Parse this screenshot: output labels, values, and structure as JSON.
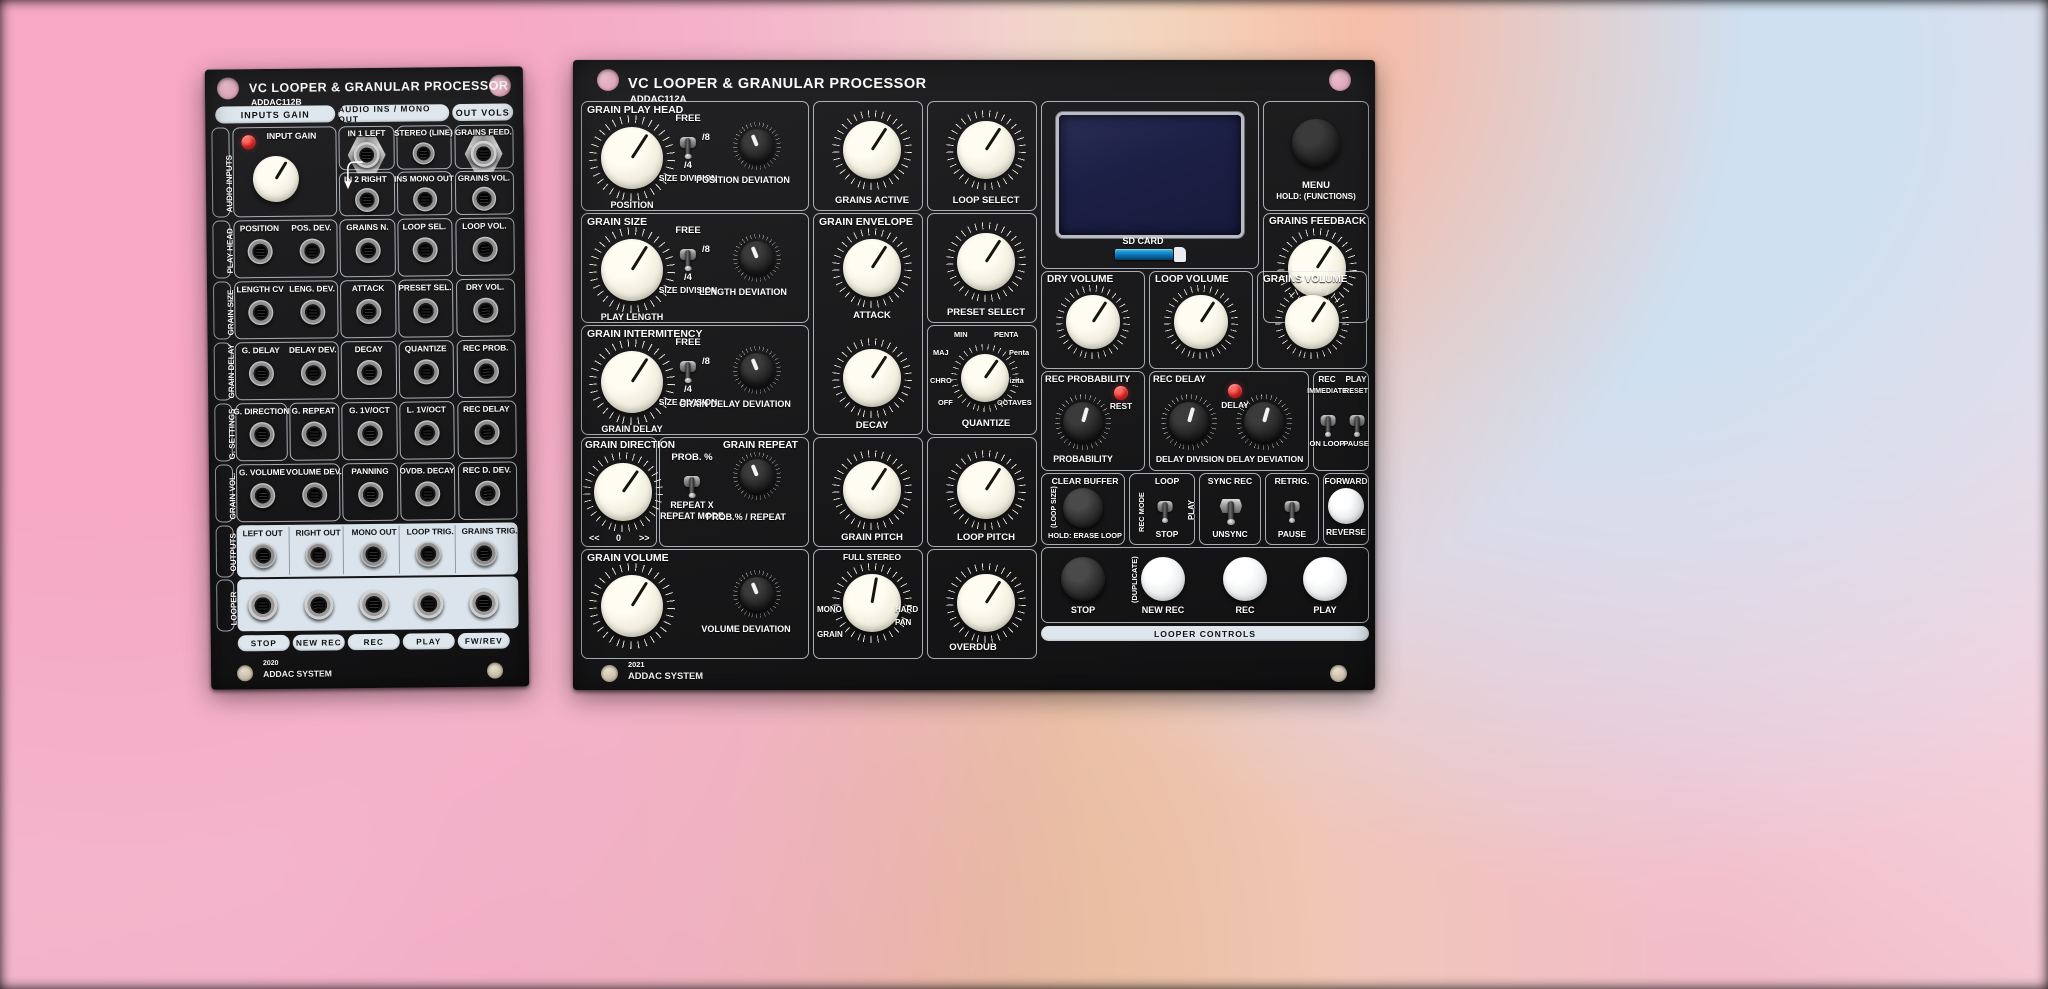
{
  "scene": {
    "background_description": "soft blurred pastel bokeh"
  },
  "module_b": {
    "title": "VC LOOPER & GRANULAR PROCESSOR",
    "model": "ADDAC112B",
    "year": "2020",
    "brand": "ADDAC SYSTEM",
    "pills": [
      "INPUTS GAIN",
      "AUDIO INS / MONO OUT",
      "OUT VOLS"
    ],
    "side_labels": [
      "AUDIO INPUTS",
      "PLAY HEAD",
      "GRAIN SIZE",
      "GRAIN DELAY",
      "G. SETTINGS",
      "GRAIN VOL.",
      "OUTPUTS",
      "LOOPER"
    ],
    "input_gain_label": "INPUT GAIN",
    "audio_in_labels": [
      "IN 1 LEFT",
      "IN 2 RIGHT",
      "STEREO (LINE)",
      "INS MONO OUT"
    ],
    "out_vol_labels": [
      "GRAINS FEED.",
      "GRAINS VOL.",
      "LOOP VOL.",
      "DRY VOL.",
      "REC PROB.",
      "REC DELAY",
      "REC D. DEV."
    ],
    "cv_rows": [
      [
        "POSITION",
        "POS. DEV.",
        "GRAINS N.",
        "LOOP SEL.",
        "LOOP VOL."
      ],
      [
        "LENGTH CV",
        "LENG. DEV.",
        "ATTACK",
        "PRESET SEL.",
        "DRY VOL."
      ],
      [
        "G. DELAY",
        "DELAY DEV.",
        "DECAY",
        "QUANTIZE",
        "REC PROB."
      ],
      [
        "G. DIRECTION",
        "G. REPEAT",
        "G. 1V/OCT",
        "L. 1V/OCT",
        "REC DELAY"
      ],
      [
        "G. VOLUME",
        "VOLUME DEV.",
        "PANNING",
        "OVDB. DECAY",
        "REC D. DEV."
      ]
    ],
    "output_labels": [
      "LEFT OUT",
      "RIGHT OUT",
      "MONO OUT",
      "LOOP TRIG.",
      "GRAINS TRIG."
    ],
    "footer_buttons": [
      "STOP",
      "NEW REC",
      "REC",
      "PLAY",
      "FW/REV"
    ]
  },
  "module_a": {
    "title": "VC LOOPER & GRANULAR PROCESSOR",
    "model": "ADDAC112A",
    "year": "2021",
    "brand": "ADDAC SYSTEM",
    "sections": {
      "grain_play_head": {
        "box_label": "GRAIN PLAY HEAD",
        "knob_label": "POSITION",
        "switch_top": "FREE",
        "switch_right": "/8",
        "switch_bottom": "/4",
        "switch_caption": "SIZE DIVISION",
        "dev_label": "POSITION DEVIATION"
      },
      "grain_size": {
        "box_label": "GRAIN SIZE",
        "knob_label": "PLAY LENGTH",
        "switch_top": "FREE",
        "switch_right": "/8",
        "switch_bottom": "/4",
        "switch_caption": "SIZE DIVISION",
        "dev_label": "LENGTH DEVIATION"
      },
      "grain_intermitency": {
        "box_label": "GRAIN INTERMITENCY",
        "knob_label": "GRAIN DELAY",
        "switch_top": "FREE",
        "switch_right": "/8",
        "switch_bottom": "/4",
        "switch_caption": "SIZE DIVISION",
        "dev_label": "GRAIN DELAY DEVIATION"
      },
      "grain_direction": {
        "box_label": "GRAIN DIRECTION",
        "scale_left": "<<",
        "scale_mid": "0",
        "scale_right": ">>"
      },
      "grain_repeat": {
        "box_label": "GRAIN REPEAT",
        "switch_top": "PROB. %",
        "switch_bottom_1": "REPEAT X",
        "switch_bottom_2": "REPEAT MODE",
        "dev_label": "PROB.% / REPEAT"
      },
      "grain_volume": {
        "box_label": "GRAIN VOLUME",
        "dev_label": "VOLUME DEVIATION"
      },
      "grains_active_label": "GRAINS ACTIVE",
      "grain_envelope": {
        "box_label": "GRAIN ENVELOPE",
        "attack": "ATTACK",
        "decay": "DECAY"
      },
      "grain_pitch_label": "GRAIN PITCH",
      "stereo": {
        "top": "FULL STEREO",
        "left": "MONO",
        "left2": "GRAIN",
        "right": "HARD",
        "right2": "PAN"
      },
      "loop_select_label": "LOOP SELECT",
      "preset_select_label": "PRESET SELECT",
      "quantize": {
        "label": "QUANTIZE",
        "marks": [
          "MIN",
          "PENTA",
          "MAJ",
          "Penta",
          "CHRO",
          "Tizita",
          "OFF",
          "OCTAVES"
        ]
      },
      "loop_pitch_label": "LOOP PITCH",
      "overdub_label": "OVERDUB",
      "menu": {
        "label": "MENU",
        "sub": "HOLD: (FUNCTIONS)"
      },
      "sd_card_label": "SD CARD",
      "grains_feedback_label": "GRAINS FEEDBACK",
      "volumes": [
        "DRY VOLUME",
        "LOOP VOLUME",
        "GRAINS VOLUME"
      ],
      "rec_probability": {
        "box_label": "REC PROBABILITY",
        "led": "REST",
        "knob": "PROBABILITY"
      },
      "rec_delay": {
        "box_label": "REC DELAY",
        "led": "DELAY",
        "knob1": "DELAY DIVISION",
        "knob2": "DELAY DEVIATION"
      },
      "rec_immediate": {
        "top1": "REC",
        "top2": "IMMEDIATE",
        "bottom": "ON LOOP"
      },
      "play_reset": {
        "top1": "PLAY",
        "top2": "RESET",
        "bottom": "PAUSE"
      },
      "clear_buffer": {
        "top": "CLEAR BUFFER",
        "side": "(LOOP SIZE)",
        "bottom": "HOLD: ERASE LOOP"
      },
      "rec_mode": {
        "side": "REC MODE",
        "top": "LOOP",
        "right": "PLAY",
        "bottom": "STOP"
      },
      "sync_rec": {
        "top": "SYNC REC",
        "bottom": "UNSYNC"
      },
      "retrig": {
        "top": "RETRIG.",
        "bottom": "PAUSE"
      },
      "forward_reverse": {
        "top": "FORWARD",
        "bottom": "REVERSE"
      },
      "transport": {
        "stop": "STOP",
        "new_rec": "NEW REC",
        "new_rec_side": "(DUPLICATE)",
        "rec": "REC",
        "play": "PLAY"
      },
      "looper_controls_label": "LOOPER CONTROLS"
    }
  }
}
